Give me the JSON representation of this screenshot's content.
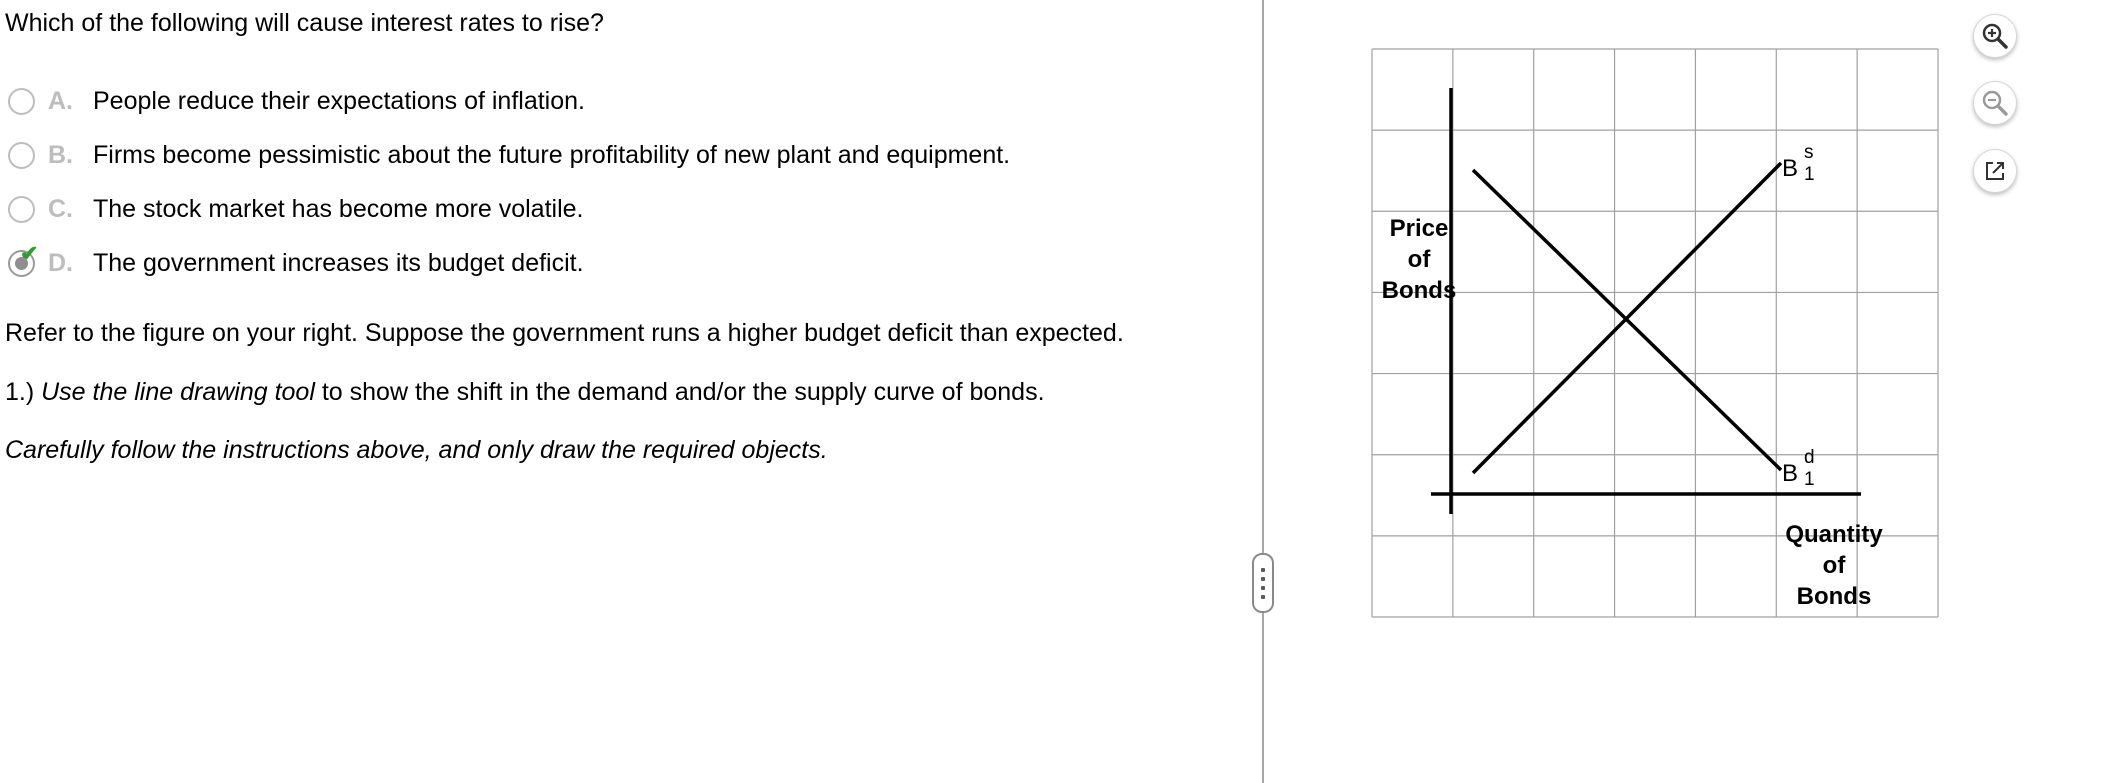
{
  "question": {
    "prompt": "Which of the following will cause interest rates to rise?",
    "choices": [
      {
        "letter": "A.",
        "text": "People reduce their expectations of inflation."
      },
      {
        "letter": "B.",
        "text": "Firms become pessimistic about the future profitability of new plant and equipment."
      },
      {
        "letter": "C.",
        "text": "The stock market has become more volatile."
      },
      {
        "letter": "D.",
        "text": "The government increases its budget deficit."
      }
    ],
    "selected_choice": "D.",
    "check_symbol": "✔"
  },
  "instructions": {
    "line1": "Refer to the figure on your right. Suppose the government runs a higher budget deficit than expected.",
    "line2_prefix": "1.) ",
    "line2_italic": "Use the line drawing tool",
    "line2_suffix": " to show the shift in the demand and/or the supply curve of bonds.",
    "line3": "Carefully follow the instructions above, and only draw the required objects."
  },
  "graph": {
    "y_axis_label": [
      "Price",
      "of",
      "Bonds"
    ],
    "x_axis_label": [
      "Quantity",
      "of",
      "Bonds"
    ],
    "supply_curve": {
      "base": "B",
      "sup": "s",
      "sub": "1"
    },
    "demand_curve": {
      "base": "B",
      "sup": "d",
      "sub": "1"
    },
    "grid": {
      "columns": 7,
      "rows": 7
    },
    "colors": {
      "grid": "#a0a0a0",
      "curves": "#000000"
    }
  },
  "tools": {
    "zoom_in": "zoom-in-icon",
    "zoom_out": "zoom-out-icon",
    "popout": "popout-icon"
  },
  "colors": {
    "accent_check": "#2e9e2e",
    "radio_border": "#bdbdbd",
    "letter": "#bdbdbd",
    "divider": "#a8a8a8"
  }
}
